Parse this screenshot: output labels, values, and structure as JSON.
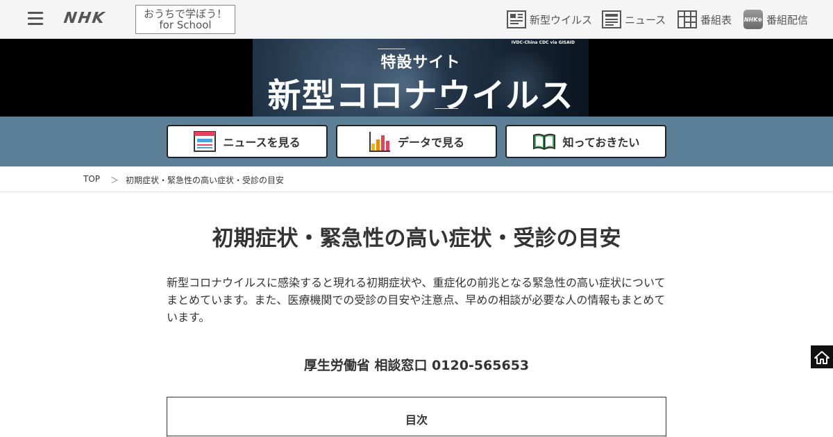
{
  "header": {
    "logo": "NHK",
    "school_line1": "おうちで学ぼう！",
    "school_line2": "for School",
    "nav": [
      {
        "label": "新型ウイルス",
        "icon": "virus-site-icon"
      },
      {
        "label": "ニュース",
        "icon": "news-icon"
      },
      {
        "label": "番組表",
        "icon": "program-guide-icon"
      },
      {
        "label": "番組配信",
        "icon": "nhk-plus-icon"
      }
    ]
  },
  "banner": {
    "credit": "IVDC-China CDC via GISAID",
    "subtitle": "特設サイト",
    "title": "新型コロナウイルス"
  },
  "section_nav": [
    {
      "label": "ニュースを見る",
      "icon": "news-window-icon"
    },
    {
      "label": "データで見る",
      "icon": "bar-chart-icon"
    },
    {
      "label": "知っておきたい",
      "icon": "open-book-icon"
    }
  ],
  "breadcrumb": {
    "top": "TOP",
    "separator": "＞",
    "current": "初期症状・緊急性の高い症状・受診の目安"
  },
  "main": {
    "title": "初期症状・緊急性の高い症状・受診の目安",
    "intro": "新型コロナウイルスに感染すると現れる初期症状や、重症化の前兆となる緊急性の高い症状についてまとめています。また、医療機関での受診の目安や注意点、早めの相談が必要な人の情報もまとめています。",
    "hotline": "厚生労働省 相談窓口 0120-565653",
    "toc_title": "目次"
  },
  "colors": {
    "section_nav_bg": "#5d8099",
    "header_bg": "#f5f5f5",
    "banner_bg": "#000000"
  }
}
